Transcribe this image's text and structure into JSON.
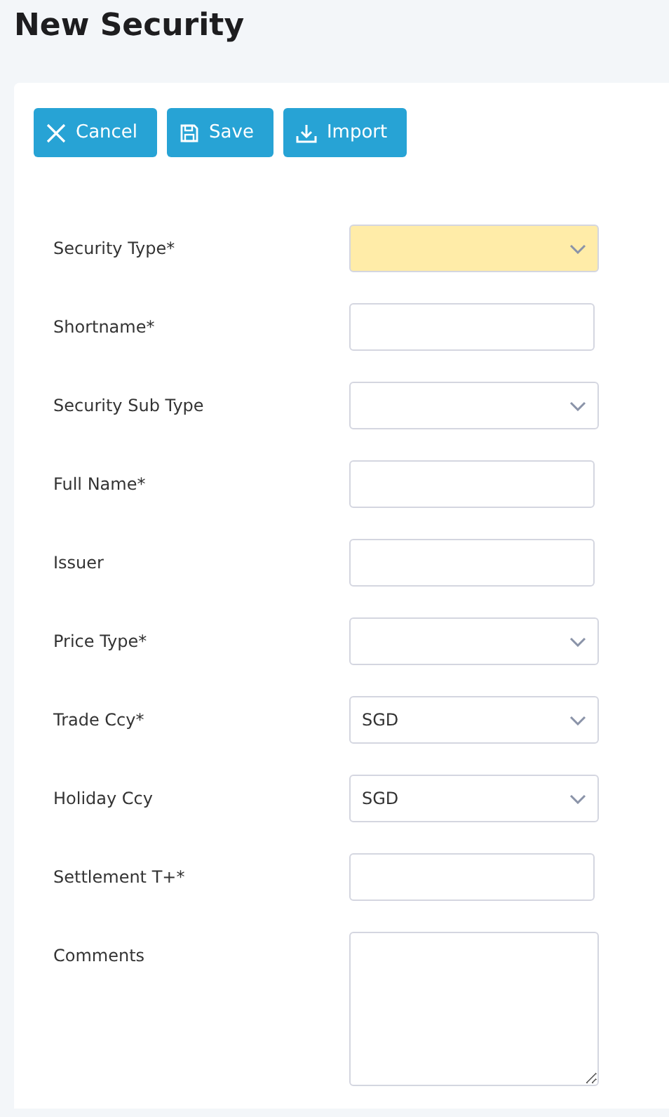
{
  "title": "New Security",
  "toolbar": [
    {
      "kind": "cancel",
      "label": "Cancel"
    },
    {
      "kind": "save",
      "label": "Save"
    },
    {
      "kind": "import",
      "label": "Import"
    }
  ],
  "fields": [
    {
      "label": "Security Type*",
      "kind": "select",
      "highlighted": true
    },
    {
      "label": "Shortname*",
      "kind": "text",
      "highlighted": false
    },
    {
      "label": "Security Sub Type",
      "kind": "select",
      "highlighted": false
    },
    {
      "label": "Full Name*",
      "kind": "text",
      "highlighted": false
    },
    {
      "label": "Issuer",
      "kind": "text",
      "highlighted": false
    },
    {
      "label": "Price Type*",
      "kind": "select",
      "highlighted": false
    },
    {
      "label": "Trade Ccy*",
      "kind": "select",
      "value": "SGD",
      "highlighted": false
    },
    {
      "label": "Holiday Ccy",
      "kind": "select",
      "value": "SGD",
      "highlighted": false
    },
    {
      "label": "Settlement T+*",
      "kind": "text",
      "highlighted": false
    },
    {
      "label": "Comments",
      "kind": "textarea",
      "highlighted": false
    }
  ]
}
